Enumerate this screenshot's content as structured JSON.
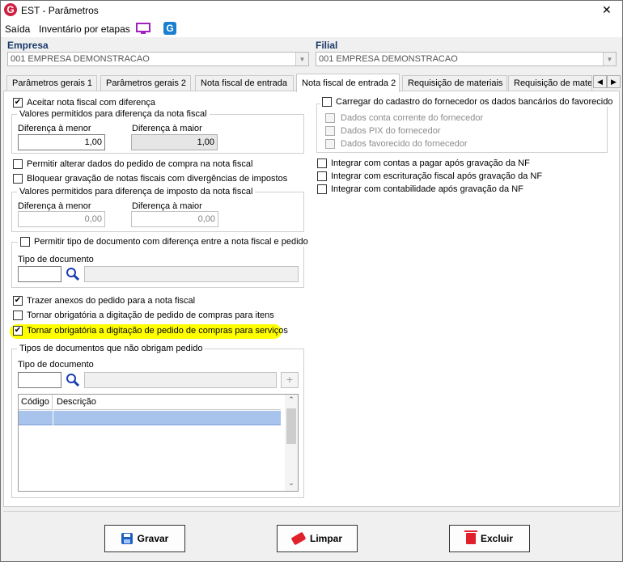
{
  "window": {
    "title": "EST - Parâmetros",
    "close_glyph": "✕"
  },
  "menu": {
    "items": [
      "Saída",
      "Inventário por etapas"
    ]
  },
  "empresa": {
    "label": "Empresa",
    "value": "001 EMPRESA DEMONSTRACAO"
  },
  "filial": {
    "label": "Filial",
    "value": "001 EMPRESA DEMONSTRACAO"
  },
  "tabs": [
    "Parâmetros gerais 1",
    "Parâmetros gerais 2",
    "Nota fiscal de entrada",
    "Nota fiscal de entrada 2",
    "Requisição de materiais",
    "Requisição de materi"
  ],
  "tab_scroll": {
    "left": "◀",
    "right": "▶"
  },
  "left": {
    "aceitar": {
      "label": "Aceitar nota fiscal com diferença",
      "checked": "✔"
    },
    "valores_group": "Valores permitidos para diferença da nota fiscal",
    "dif_menor_label": "Diferença à menor",
    "dif_menor_value": "1,00",
    "dif_maior_label": "Diferença à maior",
    "dif_maior_value": "1,00",
    "permitir_alterar": {
      "label": "Permitir alterar dados do pedido de compra na nota fiscal",
      "checked": ""
    },
    "bloquear": {
      "label": "Bloquear gravação de notas fiscais com divergências de impostos",
      "checked": ""
    },
    "imposto_group": "Valores permitidos para diferença de imposto da nota fiscal",
    "imp_menor_label": "Diferença à menor",
    "imp_menor_value": "0,00",
    "imp_maior_label": "Diferença à maior",
    "imp_maior_value": "0,00",
    "permitir_tipo": {
      "label": "Permitir tipo de documento com diferença entre a nota fiscal e pedido",
      "checked": ""
    },
    "tipo_doc_label": "Tipo de documento",
    "trazer_anexos": {
      "label": "Trazer anexos do pedido para a nota fiscal",
      "checked": "✔"
    },
    "obrig_itens": {
      "label": "Tornar obrigatória a digitação de pedido de compras para itens",
      "checked": ""
    },
    "obrig_servicos": {
      "label": "Tornar obrigatória a digitação de pedido de compras para serviços",
      "checked": "✔"
    },
    "tipos_group": "Tipos de documentos que não obrigam pedido",
    "tipos_doc_label": "Tipo de documento",
    "grid_headers": [
      "Código",
      "Descrição"
    ],
    "add_glyph": "+"
  },
  "right": {
    "carregar": {
      "label": "Carregar do cadastro do fornecedor os dados bancários do favorecido",
      "checked": ""
    },
    "dados_conta": "Dados conta corrente do fornecedor",
    "dados_pix": "Dados PIX do fornecedor",
    "dados_favorecido": "Dados favorecido do fornecedor",
    "integrar_pagar": {
      "label": "Integrar com contas a pagar após gravação da NF",
      "checked": ""
    },
    "integrar_escrit": {
      "label": "Integrar com escrituração fiscal após gravação da NF",
      "checked": ""
    },
    "integrar_contab": {
      "label": "Integrar com contabilidade após gravação da NF",
      "checked": ""
    }
  },
  "buttons": {
    "gravar": "Gravar",
    "limpar": "Limpar",
    "excluir": "Excluir"
  },
  "colors": {
    "highlight": "#ffff00",
    "accent": "#cc2244",
    "selection": "#a8c3ec"
  }
}
